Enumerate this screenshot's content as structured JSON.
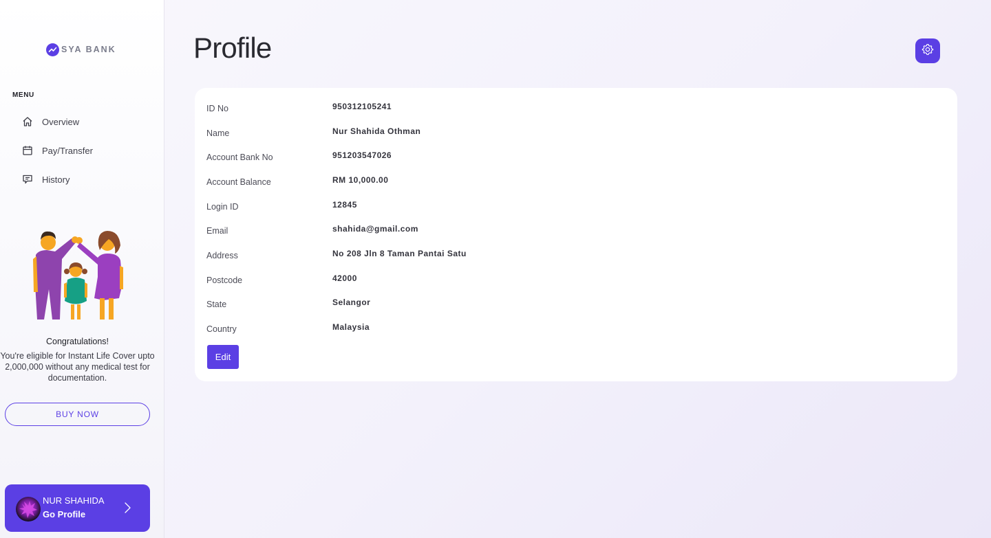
{
  "brand": {
    "name": "SYA BANK",
    "accent": "#5b3fe4"
  },
  "sidebar": {
    "menu_title": "MENU",
    "items": [
      {
        "label": "Overview",
        "icon": "home-icon"
      },
      {
        "label": "Pay/Transfer",
        "icon": "calendar-icon"
      },
      {
        "label": "History",
        "icon": "message-icon"
      }
    ],
    "promo": {
      "title": "Congratulations!",
      "body": "You're eligible for Instant Life Cover upto 2,000,000 without any medical test for documentation.",
      "button_label": "BUY NOW"
    },
    "user_card": {
      "name": "NUR SHAHIDA",
      "action": "Go Profile"
    }
  },
  "main": {
    "title": "Profile",
    "fields": [
      {
        "label": "ID No",
        "value": "950312105241"
      },
      {
        "label": "Name",
        "value": "Nur Shahida Othman"
      },
      {
        "label": "Account Bank No",
        "value": "951203547026"
      },
      {
        "label": "Account Balance",
        "value": "RM 10,000.00"
      },
      {
        "label": "Login ID",
        "value": "12845"
      },
      {
        "label": "Email",
        "value": "shahida@gmail.com"
      },
      {
        "label": "Address",
        "value": "No 208 Jln 8 Taman Pantai Satu"
      },
      {
        "label": "Postcode",
        "value": "42000"
      },
      {
        "label": "State",
        "value": "Selangor"
      },
      {
        "label": "Country",
        "value": "Malaysia"
      }
    ],
    "edit_label": "Edit"
  }
}
